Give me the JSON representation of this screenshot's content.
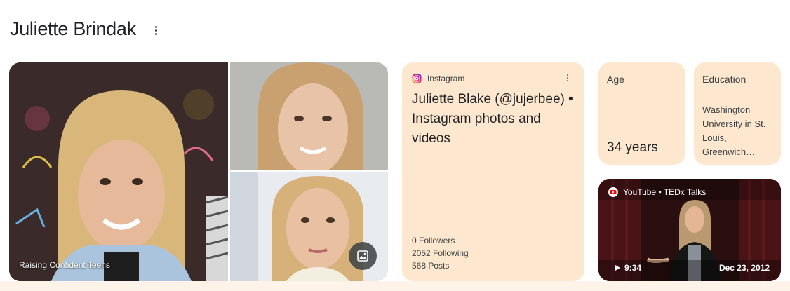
{
  "header": {
    "title": "Juliette Brindak",
    "more_icon": "three-dots-vertical-icon"
  },
  "gallery": {
    "main_caption": "Raising Confident Teens",
    "images_button_icon": "image-icon"
  },
  "instagram": {
    "source": "Instagram",
    "source_icon": "instagram-icon",
    "title": "Juliette Blake (@jujerbee) • Instagram photos and videos",
    "followers": "0 Followers",
    "following": "2052 Following",
    "posts": "568 Posts",
    "colors": {
      "card_bg": "#fde8cf"
    }
  },
  "facts": {
    "age": {
      "label": "Age",
      "value": "34 years"
    },
    "education": {
      "label": "Education",
      "value": "Washington University in St. Louis, Greenwich…"
    }
  },
  "video": {
    "source": "YouTube • TEDx Talks",
    "source_icon": "youtube-icon",
    "duration": "9:34",
    "date": "Dec 23, 2012"
  }
}
